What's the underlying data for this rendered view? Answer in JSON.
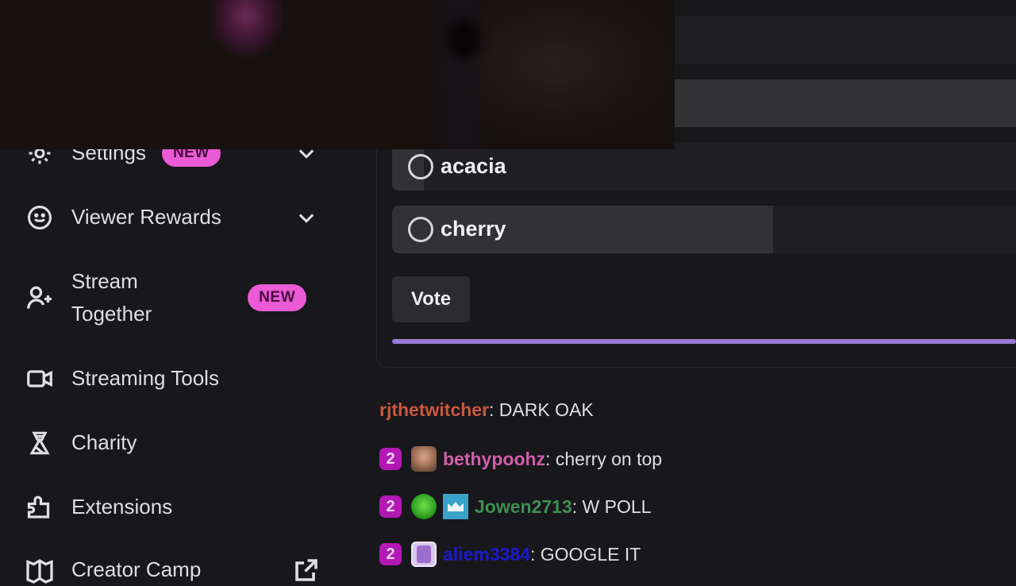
{
  "sidebar": {
    "items": [
      {
        "label": "Settings",
        "icon": "gear-icon",
        "badge": "NEW",
        "has_chevron": true
      },
      {
        "label": "Viewer Rewards",
        "icon": "smiley-icon",
        "has_chevron": true
      },
      {
        "label_line1": "Stream",
        "label_line2": "Together",
        "icon": "person-plus-icon",
        "badge": "NEW"
      },
      {
        "label": "Streaming Tools",
        "icon": "video-camera-icon"
      },
      {
        "label": "Charity",
        "icon": "charity-ribbon-icon"
      },
      {
        "label": "Extensions",
        "icon": "puzzle-piece-icon"
      },
      {
        "label": "Creator Camp",
        "icon": "book-open-icon",
        "external": true
      }
    ]
  },
  "poll": {
    "options": [
      {
        "label": "",
        "fill_percent": 0
      },
      {
        "label": "",
        "fill_percent": 100
      },
      {
        "label": "acacia",
        "fill_percent": 5
      },
      {
        "label": "cherry",
        "fill_percent": 60
      }
    ],
    "vote_label": "Vote",
    "time_remaining_percent": 100
  },
  "chat": {
    "messages": [
      {
        "user": "rjthetwitcher",
        "user_color": "#c9583f",
        "text": ": DARK OAK"
      },
      {
        "badge": "2",
        "avatar": "photo-avatar",
        "user": "bethypoohz",
        "user_color": "#d05fa8",
        "text": ": cherry on top"
      },
      {
        "badge": "2",
        "avatar": "green-avatar",
        "extra_badge": "crown-badge",
        "user": "Jowen2713",
        "user_color": "#3f8f52",
        "text": ": W POLL"
      },
      {
        "badge": "2",
        "avatar": "purple-emote-avatar",
        "user": "aliem3384",
        "user_color": "#1a1acc",
        "text": ": GOOGLE IT"
      }
    ]
  },
  "colors": {
    "background": "#18171c",
    "new_badge": "#eb5bd6",
    "timer_bar": "#9b7bd8",
    "sub_badge": "#b418b4"
  }
}
